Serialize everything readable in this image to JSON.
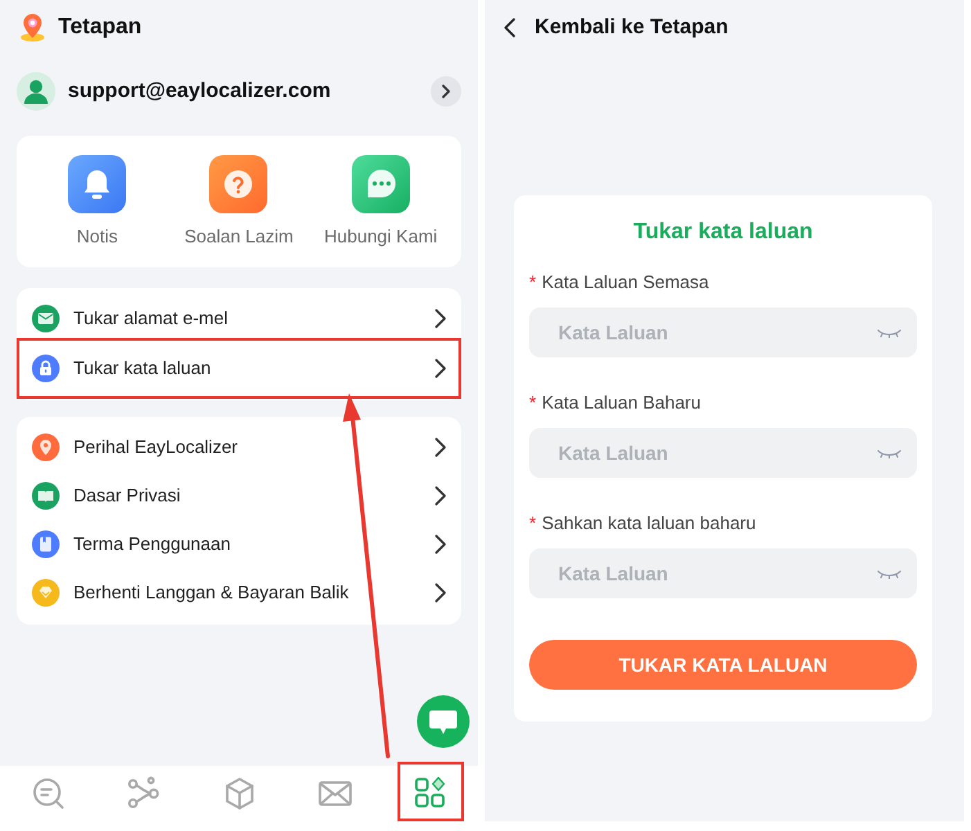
{
  "left_screen": {
    "header": {
      "title": "Tetapan"
    },
    "account": {
      "email": "support@eaylocalizer.com"
    },
    "quick_actions": [
      {
        "kind": "bell",
        "label": "Notis"
      },
      {
        "kind": "question",
        "label": "Soalan Lazim"
      },
      {
        "kind": "chat",
        "label": "Hubungi Kami"
      }
    ],
    "menu_groups": [
      {
        "items": [
          {
            "kind": "mail",
            "label": "Tukar alamat e-mel",
            "highlighted": false
          },
          {
            "kind": "lock",
            "label": "Tukar kata laluan",
            "highlighted": true
          }
        ]
      },
      {
        "items": [
          {
            "kind": "pin",
            "label": "Perihal EayLocalizer",
            "highlighted": false
          },
          {
            "kind": "book",
            "label": "Dasar Privasi",
            "highlighted": false
          },
          {
            "kind": "document",
            "label": "Terma Penggunaan",
            "highlighted": false
          },
          {
            "kind": "gem",
            "label": "Berhenti Langgan & Bayaran Balik",
            "highlighted": false
          }
        ]
      }
    ],
    "nav_items": [
      {
        "kind": "search",
        "selected": false,
        "highlighted": false
      },
      {
        "kind": "share",
        "selected": false,
        "highlighted": false
      },
      {
        "kind": "box",
        "selected": false,
        "highlighted": false
      },
      {
        "kind": "mail",
        "selected": false,
        "highlighted": false
      },
      {
        "kind": "apps",
        "selected": true,
        "highlighted": true
      }
    ]
  },
  "right_screen": {
    "header": {
      "title": "Kembali ke Tetapan"
    },
    "form": {
      "title": "Tukar kata laluan",
      "fields": [
        {
          "mark": "*",
          "label": "Kata Laluan Semasa",
          "placeholder": "Kata Laluan"
        },
        {
          "mark": "*",
          "label": "Kata Laluan Baharu",
          "placeholder": "Kata Laluan"
        },
        {
          "mark": "*",
          "label": "Sahkan kata laluan baharu",
          "placeholder": "Kata Laluan"
        }
      ],
      "submit": "TUKAR KATA LALUAN"
    }
  }
}
